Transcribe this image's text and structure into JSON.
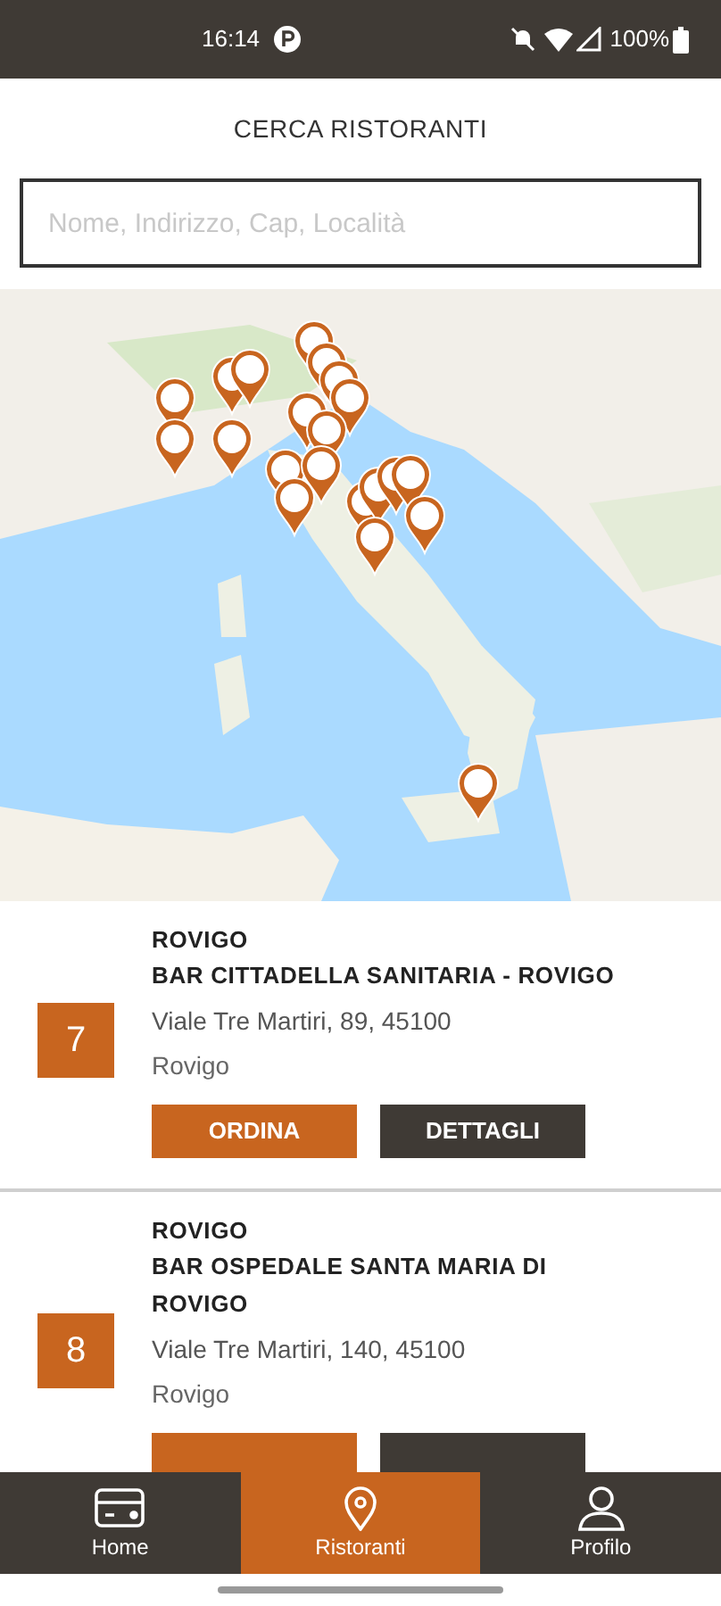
{
  "status_bar": {
    "time": "16:14",
    "battery": "100%"
  },
  "header": {
    "title": "CERCA RISTORANTI"
  },
  "search": {
    "placeholder": "Nome, Indirizzo, Cap, Località"
  },
  "restaurants": [
    {
      "number": "7",
      "city": "ROVIGO",
      "name": "BAR CITTADELLA SANITARIA - ROVIGO",
      "address": "Viale Tre Martiri, 89, 45100",
      "locality": "Rovigo",
      "actions": [
        {
          "kind": "order",
          "label": "ORDINA"
        },
        {
          "kind": "details",
          "label": "DETTAGLI"
        }
      ]
    },
    {
      "number": "8",
      "city": "ROVIGO",
      "name": "BAR OSPEDALE SANTA MARIA  DI ROVIGO",
      "address": "Viale Tre Martiri, 140, 45100",
      "locality": "Rovigo",
      "actions": [
        {
          "kind": "order"
        },
        {
          "kind": "details"
        }
      ]
    }
  ],
  "bottom_nav": [
    {
      "kind": "home",
      "label": "Home",
      "selected": false
    },
    {
      "kind": "restaurants",
      "label": "Ristoranti",
      "selected": true
    },
    {
      "kind": "profile",
      "label": "Profilo",
      "selected": false
    }
  ]
}
